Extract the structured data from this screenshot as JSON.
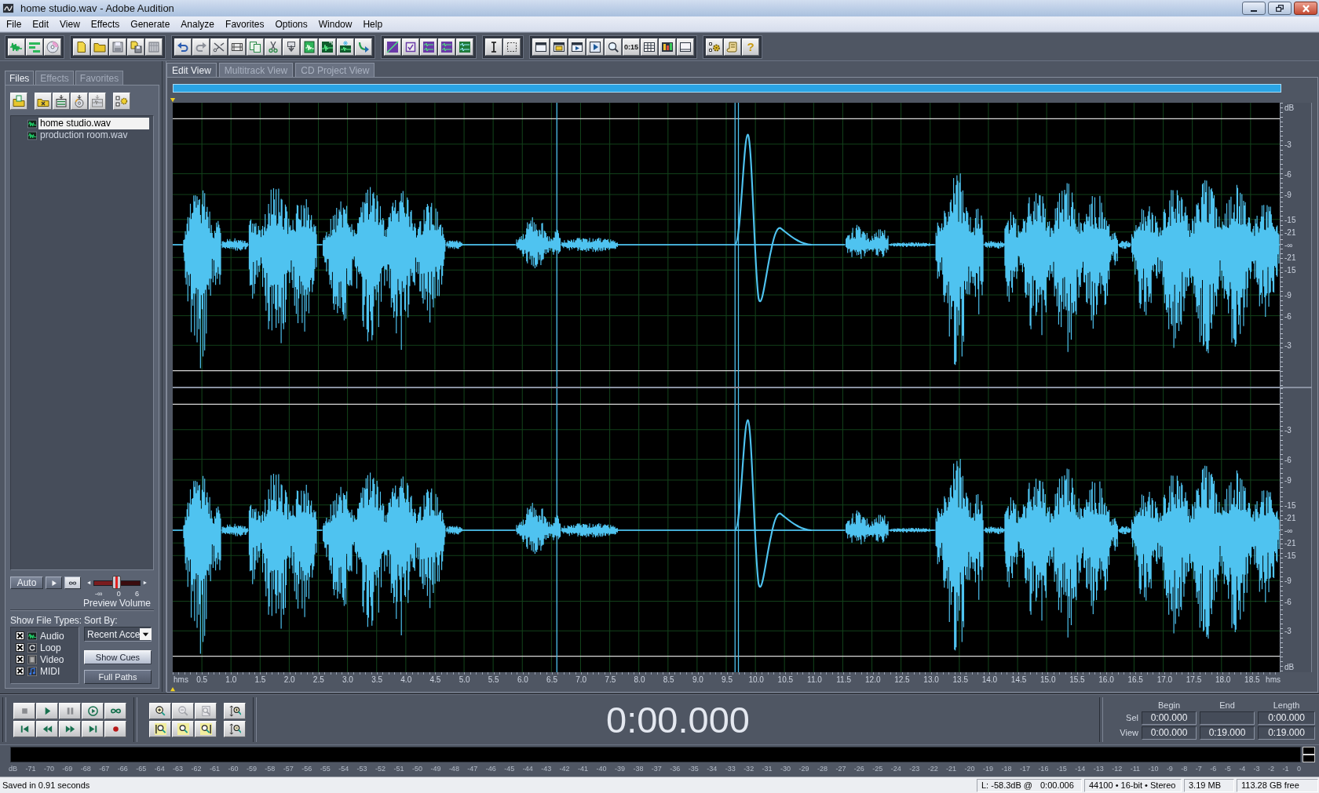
{
  "window": {
    "title": "home studio.wav - Adobe Audition"
  },
  "menu": [
    "File",
    "Edit",
    "View",
    "Effects",
    "Generate",
    "Analyze",
    "Favorites",
    "Options",
    "Window",
    "Help"
  ],
  "toolbar": {
    "time_button_label": "0:15",
    "help_button_label": "?"
  },
  "left_panel": {
    "tabs": [
      {
        "label": "Files",
        "selected": true
      },
      {
        "label": "Effects",
        "selected": false
      },
      {
        "label": "Favorites",
        "selected": false
      }
    ],
    "files": [
      {
        "name": "home studio.wav",
        "selected": true
      },
      {
        "name": "production room.wav",
        "selected": false
      }
    ],
    "preview": {
      "auto_button": "Auto",
      "loop_on": true,
      "volume": {
        "level": 0.5,
        "min_label": "-∞",
        "mid_label": "0",
        "max_label": "6",
        "label": "Preview Volume"
      }
    },
    "file_types": {
      "title": "Show File Types:",
      "items": [
        {
          "label": "Audio",
          "checked": true,
          "kind": "audio"
        },
        {
          "label": "Loop",
          "checked": true,
          "kind": "loop"
        },
        {
          "label": "Video",
          "checked": true,
          "kind": "video"
        },
        {
          "label": "MIDI",
          "checked": true,
          "kind": "midi"
        }
      ]
    },
    "sort": {
      "title": "Sort By:",
      "value": "Recent Acce"
    },
    "buttons": [
      {
        "label": "Show Cues",
        "on": true
      },
      {
        "label": "Full Paths",
        "on": false
      }
    ]
  },
  "view_tabs": [
    {
      "label": "Edit View",
      "selected": true
    },
    {
      "label": "Multitrack View",
      "selected": false
    },
    {
      "label": "CD Project View",
      "selected": false
    }
  ],
  "waveform": {
    "channels": [
      {
        "top_label": "dB",
        "ticks": [
          "-3",
          "-6",
          "-9",
          "-15",
          "-21",
          "-∞",
          "-21",
          "-15",
          "-9",
          "-6",
          "-3"
        ]
      },
      {
        "ticks": [
          "-3",
          "-6",
          "-9",
          "-15",
          "-21",
          "-∞",
          "-21",
          "-15",
          "-9",
          "-6",
          "-3"
        ],
        "bottom_label": "dB"
      }
    ],
    "ruler": {
      "unit_left": "hms",
      "labels": [
        "0.5",
        "1.0",
        "1.5",
        "2.0",
        "2.5",
        "3.0",
        "3.5",
        "4.0",
        "4.5",
        "5.0",
        "5.5",
        "6.0",
        "6.5",
        "7.0",
        "7.5",
        "8.0",
        "8.5",
        "9.0",
        "9.5",
        "10.0",
        "10.5",
        "11.0",
        "11.5",
        "12.0",
        "12.5",
        "13.0",
        "13.5",
        "14.0",
        "14.5",
        "15.0",
        "15.5",
        "16.0",
        "16.5",
        "17.0",
        "17.5",
        "18.0",
        "18.5"
      ],
      "unit_right": "hms"
    }
  },
  "transport": {
    "time": "0:00.000"
  },
  "selection": {
    "columns": [
      "Begin",
      "End",
      "Length"
    ],
    "rows": [
      {
        "label": "Sel",
        "begin": "0:00.000",
        "length": "0:00.000"
      },
      {
        "label": "View",
        "begin": "0:00.000",
        "end": "0:19.000",
        "length": "0:19.000"
      }
    ]
  },
  "level_meter": {
    "labels": [
      "dB",
      "-71",
      "-70",
      "-69",
      "-68",
      "-67",
      "-66",
      "-65",
      "-64",
      "-63",
      "-62",
      "-61",
      "-60",
      "-59",
      "-58",
      "-57",
      "-56",
      "-55",
      "-54",
      "-53",
      "-52",
      "-51",
      "-50",
      "-49",
      "-48",
      "-47",
      "-46",
      "-45",
      "-44",
      "-43",
      "-42",
      "-41",
      "-40",
      "-39",
      "-38",
      "-37",
      "-36",
      "-35",
      "-34",
      "-33",
      "-32",
      "-31",
      "-30",
      "-29",
      "-28",
      "-27",
      "-26",
      "-25",
      "-24",
      "-23",
      "-22",
      "-21",
      "-20",
      "-19",
      "-18",
      "-17",
      "-16",
      "-15",
      "-14",
      "-13",
      "-12",
      "-11",
      "-10",
      "-9",
      "-8",
      "-7",
      "-6",
      "-5",
      "-4",
      "-3",
      "-2",
      "-1",
      "0"
    ]
  },
  "status_bar": {
    "message": "Saved in 0.91 seconds",
    "level_reading": "L: -58.3dB @",
    "level_time": "0:00.006",
    "format": "44100 • 16-bit • Stereo",
    "size": "3.19 MB",
    "free_space": "113.28 GB free"
  }
}
